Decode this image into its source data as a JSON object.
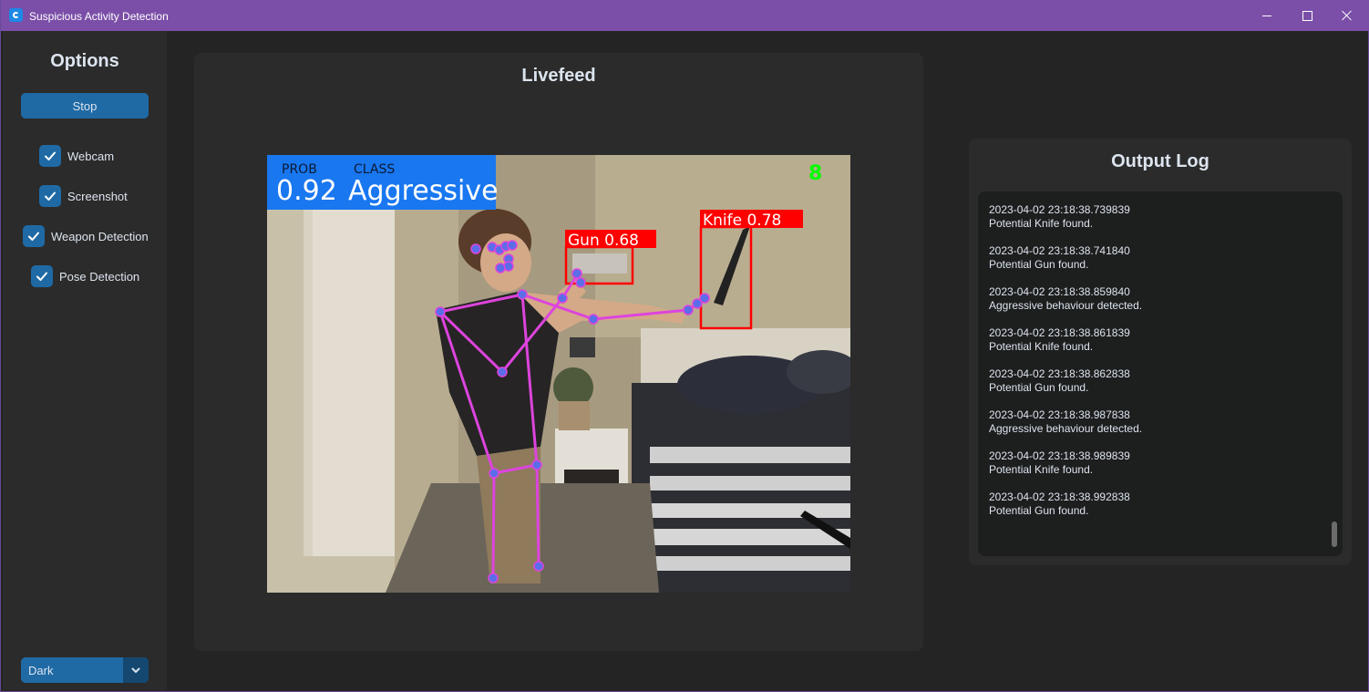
{
  "window": {
    "title": "Suspicious Activity Detection",
    "accent": "#7b4fa8"
  },
  "sidebar": {
    "title": "Options",
    "stop_label": "Stop",
    "checkboxes": [
      {
        "label": "Webcam",
        "checked": true
      },
      {
        "label": "Screenshot",
        "checked": true
      },
      {
        "label": "Weapon Detection",
        "checked": true
      },
      {
        "label": "Pose Detection",
        "checked": true
      }
    ],
    "theme": {
      "value": "Dark",
      "icon": "chevron-down-icon"
    }
  },
  "feed": {
    "title": "Livefeed",
    "overlay": {
      "prob_header": "PROB",
      "class_header": "CLASS",
      "prob_value": "0.92",
      "class_value": "Aggressive",
      "count": "8",
      "detections": [
        {
          "label": "Gun 0.68"
        },
        {
          "label": "Knife 0.78"
        }
      ],
      "colors": {
        "banner": "#1977f0",
        "box": "#ff0000",
        "skeleton": "#dd44dd",
        "keypoint": "#5a6ee8",
        "count": "#00ff00"
      }
    }
  },
  "log": {
    "title": "Output Log",
    "entries": [
      {
        "time": "2023-04-02 23:18:38.739839",
        "message": "Potential Knife found."
      },
      {
        "time": "2023-04-02 23:18:38.741840",
        "message": "Potential Gun found."
      },
      {
        "time": "2023-04-02 23:18:38.859840",
        "message": "Aggressive behaviour detected."
      },
      {
        "time": "2023-04-02 23:18:38.861839",
        "message": "Potential Knife found."
      },
      {
        "time": "2023-04-02 23:18:38.862838",
        "message": "Potential Gun found."
      },
      {
        "time": "2023-04-02 23:18:38.987838",
        "message": "Aggressive behaviour detected."
      },
      {
        "time": "2023-04-02 23:18:38.989839",
        "message": "Potential Knife found."
      },
      {
        "time": "2023-04-02 23:18:38.992838",
        "message": "Potential Gun found."
      }
    ]
  }
}
